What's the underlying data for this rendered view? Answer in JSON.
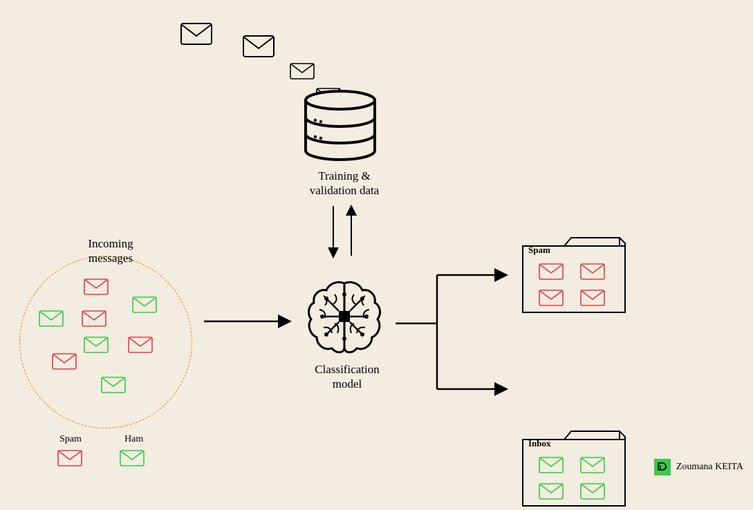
{
  "labels": {
    "incoming": "Incoming\nmessages",
    "training": "Training &\nvalidation data",
    "model": "Classification\nmodel",
    "spam_folder": "Spam",
    "inbox_folder": "Inbox",
    "legend_spam": "Spam",
    "legend_ham": "Ham",
    "credit": "Zoumana KEITA"
  },
  "icons": {
    "envelope": "envelope-icon",
    "database": "database-icon",
    "brain": "brain-icon",
    "folder": "folder-icon",
    "arrow": "arrow-icon",
    "logo": "dc-logo"
  },
  "colors": {
    "spam": "#e63946",
    "ham": "#2ecc40",
    "stroke": "#000000",
    "bg": "#f3ece0",
    "badge": "#3cc84e",
    "orange": "#e68a00"
  }
}
